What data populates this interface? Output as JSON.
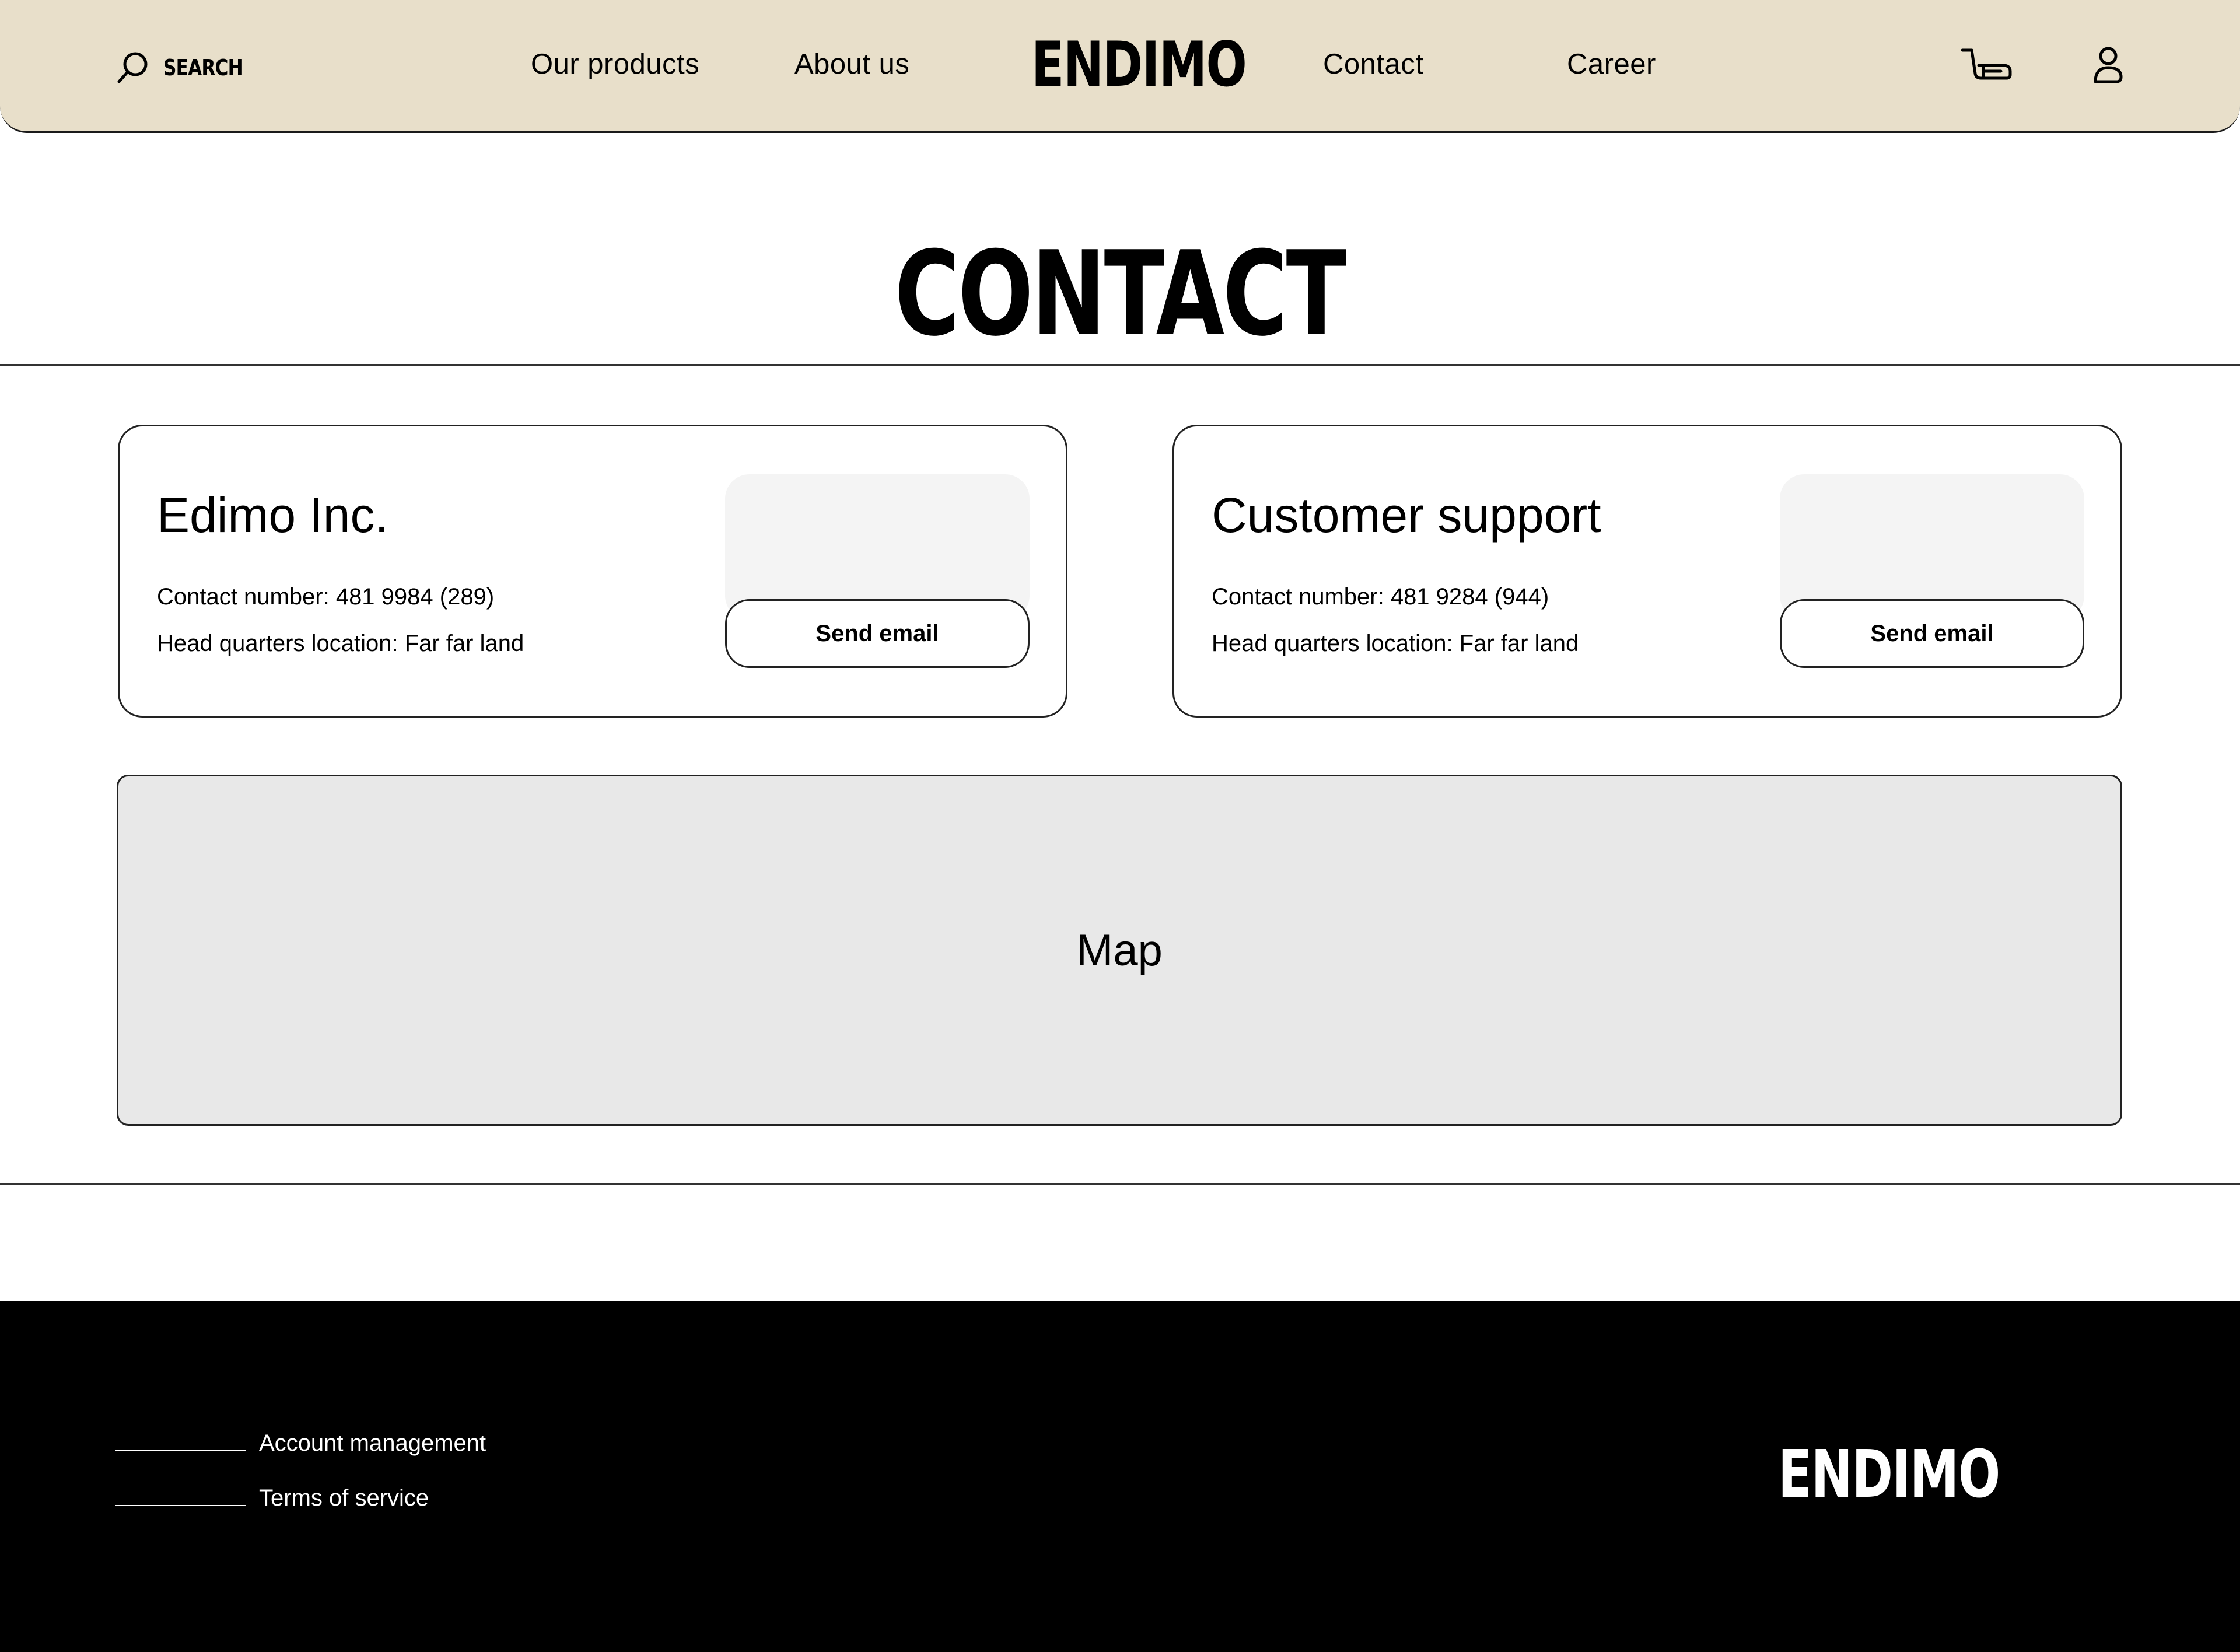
{
  "colors": {
    "header_bg": "#e8dfca",
    "footer_bg": "#000000",
    "map_bg": "#e8e8e8",
    "card_image_bg": "#f4f4f4",
    "text": "#000000"
  },
  "header": {
    "search_label": "SEARCH",
    "search_icon": "search-icon",
    "nav": [
      {
        "label": "Our products"
      },
      {
        "label": "About us"
      },
      {
        "label": "Contact"
      },
      {
        "label": "Career"
      }
    ],
    "logo": "ENDIMO",
    "cart_icon": "cart-icon",
    "account_icon": "user-icon"
  },
  "main": {
    "title": "CONTACT",
    "cards": [
      {
        "title": "Edimo Inc.",
        "contact_line": "Contact number: 481 9984 (289)",
        "location_line": "Head quarters location: Far far land",
        "button_label": "Send email"
      },
      {
        "title": "Customer support",
        "contact_line": "Contact number: 481 9284 (944)",
        "location_line": "Head quarters location: Far far land",
        "button_label": "Send email"
      }
    ],
    "map_label": "Map"
  },
  "footer": {
    "links": [
      {
        "label": "Account management"
      },
      {
        "label": "Terms of service"
      }
    ],
    "logo": "ENDIMO"
  }
}
